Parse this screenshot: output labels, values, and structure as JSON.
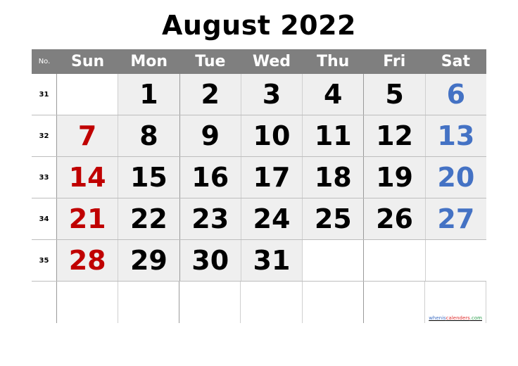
{
  "title": "August 2022",
  "header": {
    "no_label": "No.",
    "days": [
      "Sun",
      "Mon",
      "Tue",
      "Wed",
      "Thu",
      "Fri",
      "Sat"
    ]
  },
  "colors": {
    "sunday": "#c00000",
    "saturday": "#4472c4",
    "header_bg": "#7f7f7f",
    "filled_cell_bg": "#efefef"
  },
  "weeks": [
    {
      "week_no": "31",
      "days": [
        "",
        "1",
        "2",
        "3",
        "4",
        "5",
        "6"
      ]
    },
    {
      "week_no": "32",
      "days": [
        "7",
        "8",
        "9",
        "10",
        "11",
        "12",
        "13"
      ]
    },
    {
      "week_no": "33",
      "days": [
        "14",
        "15",
        "16",
        "17",
        "18",
        "19",
        "20"
      ]
    },
    {
      "week_no": "34",
      "days": [
        "21",
        "22",
        "23",
        "24",
        "25",
        "26",
        "27"
      ]
    },
    {
      "week_no": "35",
      "days": [
        "28",
        "29",
        "30",
        "31",
        "",
        "",
        ""
      ]
    },
    {
      "week_no": "",
      "days": [
        "",
        "",
        "",
        "",
        "",
        "",
        ""
      ]
    }
  ],
  "credit": {
    "part1": "whenis",
    "part2": "calenders",
    "part3": ".com"
  }
}
